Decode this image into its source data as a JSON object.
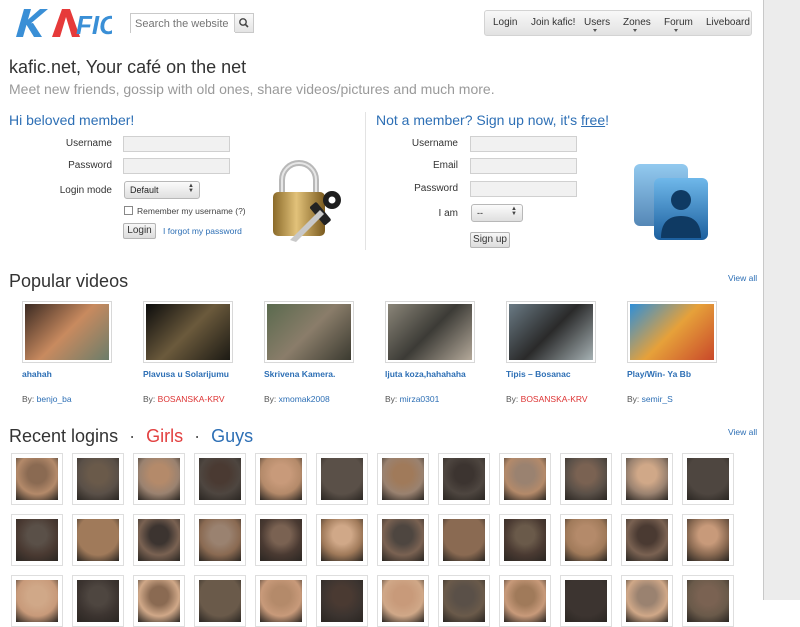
{
  "header": {
    "search_placeholder": "Search the website",
    "nav": [
      "Login",
      "Join kafic!",
      "Users",
      "Zones",
      "Forum",
      "Liveboard"
    ],
    "logo_text": "KAFIC"
  },
  "intro": {
    "title": "kafic.net, Your café on the net",
    "tagline": "Meet new friends, gossip with old ones, share videos/pictures and much more."
  },
  "login": {
    "heading": "Hi beloved member!",
    "username_label": "Username",
    "password_label": "Password",
    "mode_label": "Login mode",
    "mode_value": "Default",
    "remember_label": "Remember my username (?)",
    "login_button": "Login",
    "forgot_link": "I forgot my password"
  },
  "signup": {
    "heading_prefix": "Not a member? Sign up now, it's ",
    "heading_link": "free",
    "heading_suffix": "!",
    "username_label": "Username",
    "email_label": "Email",
    "password_label": "Password",
    "iam_label": "I am",
    "iam_value": "--",
    "signup_button": "Sign up"
  },
  "videos": {
    "heading": "Popular videos",
    "view_all": "View all",
    "by_label": "By:",
    "items": [
      {
        "title": "ahahah",
        "user": "benjo_ba",
        "user_color": "blue"
      },
      {
        "title": "Plavusa u Solarijumu",
        "user": "BOSANSKA-KRV",
        "user_color": "red"
      },
      {
        "title": "Skrivena Kamera.",
        "user": "xmomak2008",
        "user_color": "blue"
      },
      {
        "title": "ljuta koza,hahahaha",
        "user": "mirza0301",
        "user_color": "blue"
      },
      {
        "title": "Tipis – Bosanac",
        "user": "BOSANSKA-KRV",
        "user_color": "red"
      },
      {
        "title": "Play/Win- Ya Bb",
        "user": "semir_S",
        "user_color": "blue"
      }
    ]
  },
  "recent": {
    "heading": "Recent logins",
    "sep": "·",
    "girls": "Girls",
    "guys": "Guys",
    "view_all": "View all"
  },
  "colors": {
    "link": "#2d6fb5",
    "accent_red": "#e24040"
  }
}
